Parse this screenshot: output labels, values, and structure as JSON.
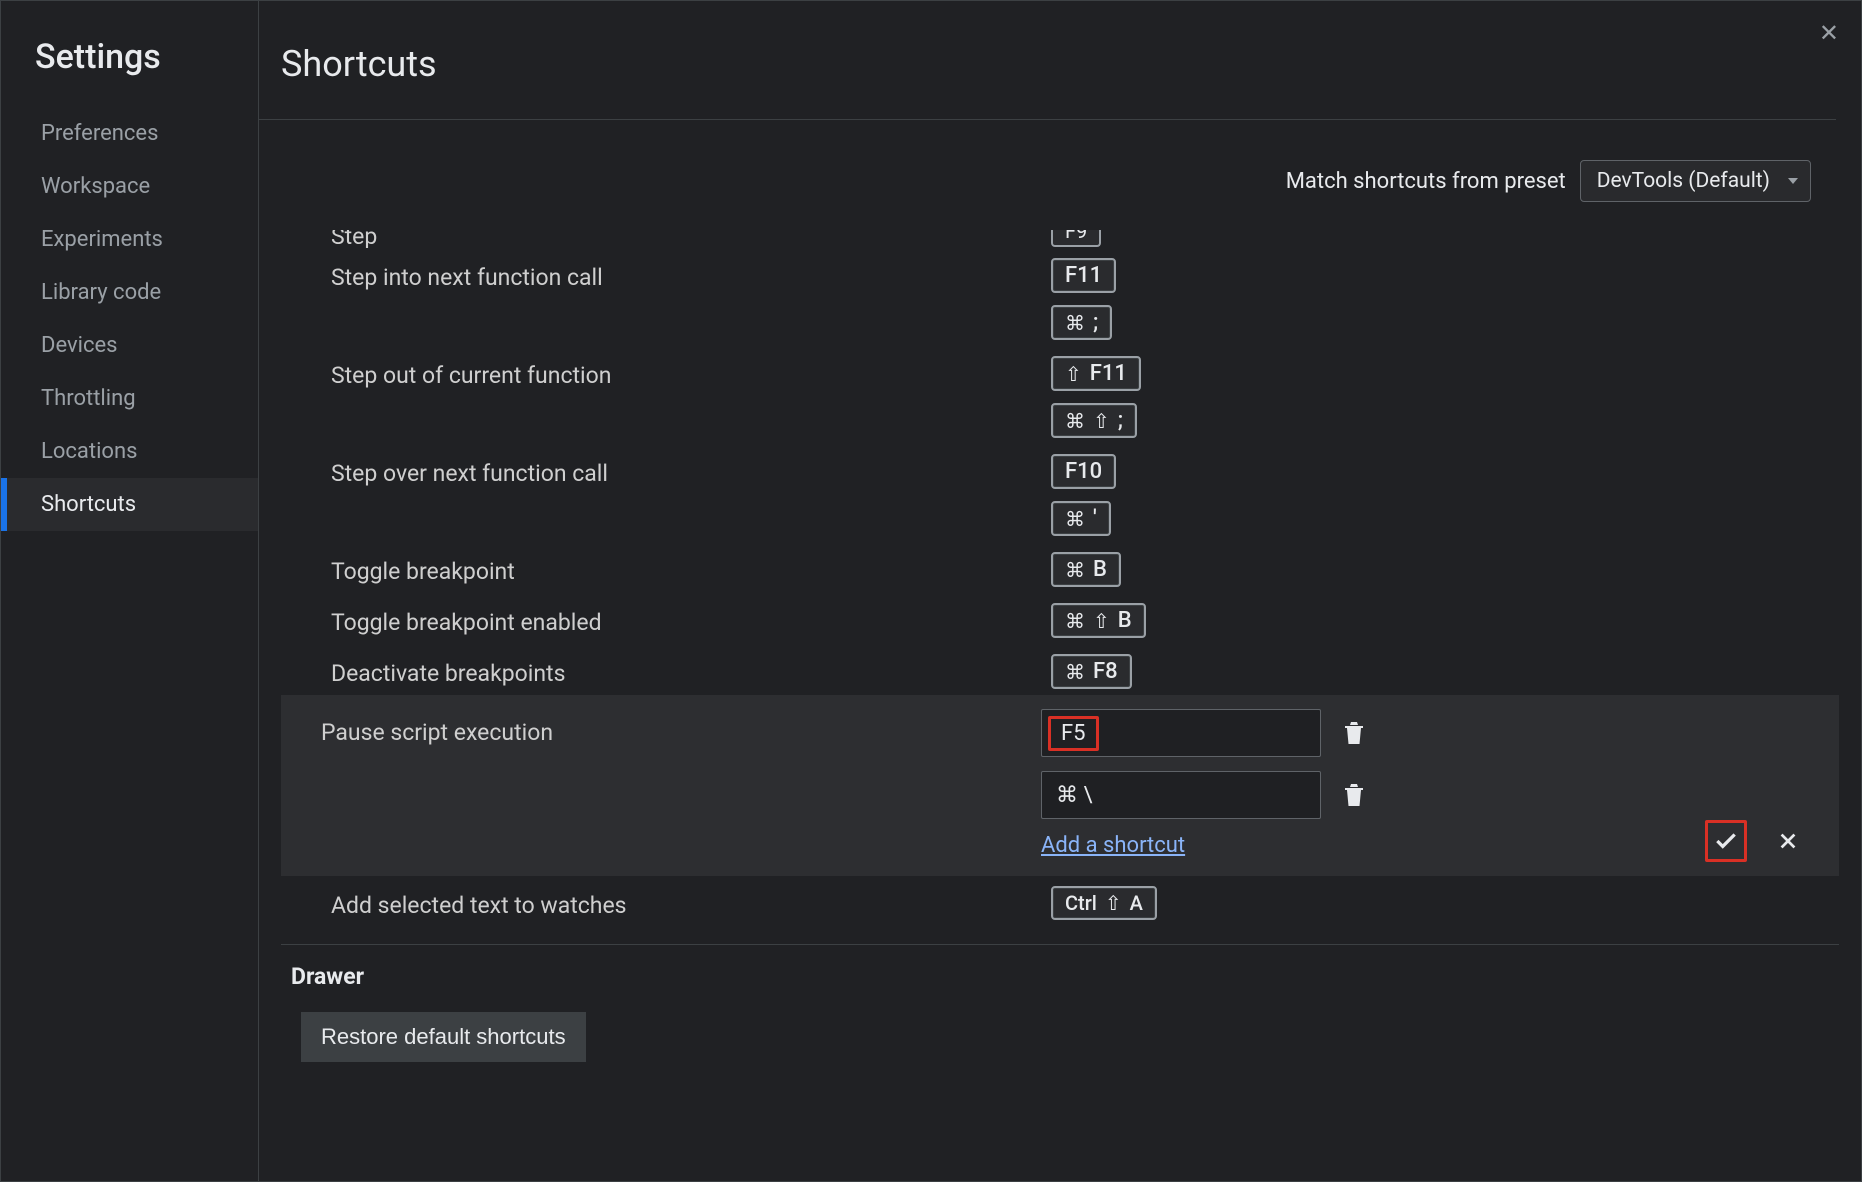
{
  "sidebar": {
    "title": "Settings",
    "items": [
      {
        "label": "Preferences",
        "active": false
      },
      {
        "label": "Workspace",
        "active": false
      },
      {
        "label": "Experiments",
        "active": false
      },
      {
        "label": "Library code",
        "active": false
      },
      {
        "label": "Devices",
        "active": false
      },
      {
        "label": "Throttling",
        "active": false
      },
      {
        "label": "Locations",
        "active": false
      },
      {
        "label": "Shortcuts",
        "active": true
      }
    ]
  },
  "header": {
    "title": "Shortcuts",
    "preset_label": "Match shortcuts from preset",
    "preset_value": "DevTools (Default)"
  },
  "truncated": {
    "label": "Step",
    "key": "F9"
  },
  "shortcuts": [
    {
      "label": "Step into next function call",
      "keys": [
        [
          "F11"
        ],
        [
          "⌘",
          ";"
        ]
      ]
    },
    {
      "label": "Step out of current function",
      "keys": [
        [
          "⇧",
          "F11"
        ],
        [
          "⌘",
          "⇧",
          ";"
        ]
      ]
    },
    {
      "label": "Step over next function call",
      "keys": [
        [
          "F10"
        ],
        [
          "⌘",
          "'"
        ]
      ]
    },
    {
      "label": "Toggle breakpoint",
      "keys": [
        [
          "⌘",
          "B"
        ]
      ]
    },
    {
      "label": "Toggle breakpoint enabled",
      "keys": [
        [
          "⌘",
          "⇧",
          "B"
        ]
      ]
    },
    {
      "label": "Deactivate breakpoints",
      "keys": [
        [
          "⌘",
          "F8"
        ]
      ]
    }
  ],
  "editing": {
    "label": "Pause script execution",
    "input1": "F5",
    "input2_parts": [
      "⌘",
      "\\"
    ],
    "add_link": "Add a shortcut"
  },
  "after": [
    {
      "label": "Add selected text to watches",
      "keys": [
        [
          "Ctrl",
          "⇧",
          "A"
        ]
      ]
    }
  ],
  "section": "Drawer",
  "restore_label": "Restore default shortcuts"
}
